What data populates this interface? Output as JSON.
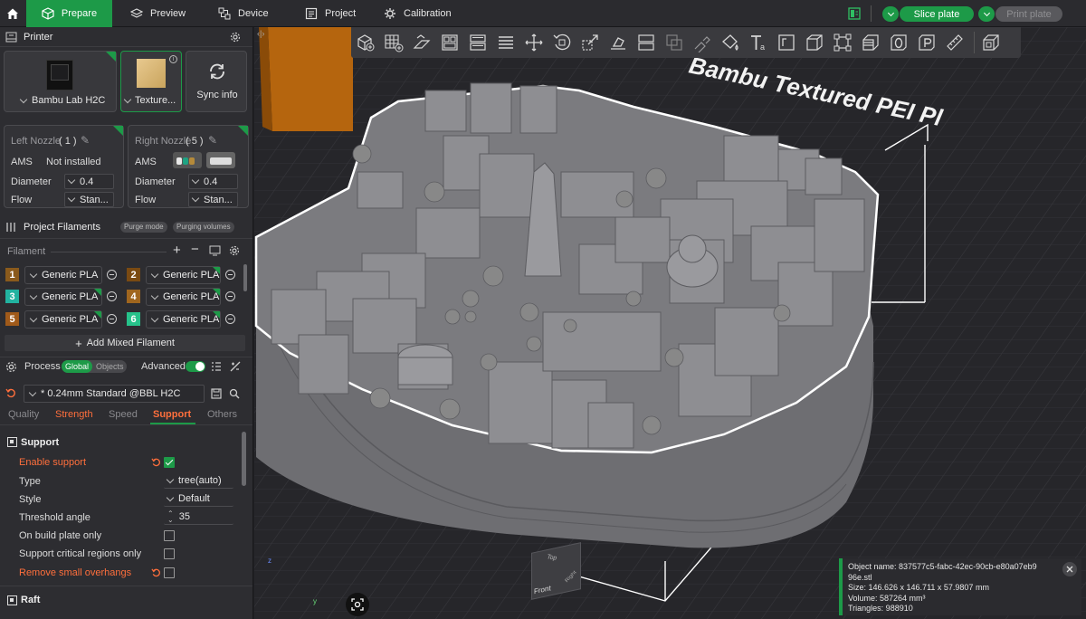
{
  "tabs": [
    {
      "label": "Prepare",
      "icon": "box-icon"
    },
    {
      "label": "Preview",
      "icon": "layers-icon"
    },
    {
      "label": "Device",
      "icon": "device-icon"
    },
    {
      "label": "Project",
      "icon": "project-icon"
    },
    {
      "label": "Calibration",
      "icon": "calibration-icon"
    }
  ],
  "topright": {
    "slice_label": "Slice plate",
    "print_label": "Print plate"
  },
  "printer": {
    "header": "Printer",
    "name": "Bambu Lab H2C",
    "plate": "Texture...",
    "sync": "Sync info",
    "left_nozzle": {
      "title": "Left Nozzle",
      "count": "( 1 )",
      "ams_label": "AMS",
      "ams_value": "Not installed",
      "diameter_label": "Diameter",
      "diameter": "0.4",
      "flow_label": "Flow",
      "flow": "Stan..."
    },
    "right_nozzle": {
      "title": "Right Nozzle",
      "count": "( 5 )",
      "ams_label": "AMS",
      "diameter_label": "Diameter",
      "diameter": "0.4",
      "flow_label": "Flow",
      "flow": "Stan..."
    }
  },
  "filaments": {
    "header": "Project Filaments",
    "purge_mode": "Purge mode",
    "purging_volumes": "Purging volumes",
    "label": "Filament",
    "items": [
      {
        "num": "1",
        "name": "Generic PLA",
        "color": "#8a5a1c"
      },
      {
        "num": "2",
        "name": "Generic PLA",
        "color": "#7a4a12"
      },
      {
        "num": "3",
        "name": "Generic PLA",
        "color": "#22b3a0"
      },
      {
        "num": "4",
        "name": "Generic PLA",
        "color": "#a0661e"
      },
      {
        "num": "5",
        "name": "Generic PLA",
        "color": "#a05a1a"
      },
      {
        "num": "6",
        "name": "Generic PLA",
        "color": "#26c28a"
      }
    ],
    "add_mixed": "Add Mixed Filament"
  },
  "process": {
    "header": "Process",
    "global": "Global",
    "objects": "Objects",
    "advanced": "Advanced",
    "preset": "* 0.24mm Standard @BBL H2C",
    "tabs": [
      "Quality",
      "Strength",
      "Speed",
      "Support",
      "Others"
    ],
    "active_tab": "Support"
  },
  "support": {
    "header": "Support",
    "enable_label": "Enable support",
    "type_label": "Type",
    "type_value": "tree(auto)",
    "style_label": "Style",
    "style_value": "Default",
    "threshold_label": "Threshold angle",
    "threshold_value": "35",
    "build_plate_label": "On build plate only",
    "critical_label": "Support critical regions only",
    "overhangs_label": "Remove small overhangs",
    "raft_header": "Raft"
  },
  "viewport": {
    "plate_text": "Bambu Textured PEI Pl",
    "cube_top": "Top",
    "cube_front": "Front",
    "cube_right": "Right",
    "axis_z": "z",
    "axis_y": "y"
  },
  "object_info": {
    "name": "Object name: 837577c5-fabc-42ec-90cb-e80a07eb9",
    "name2": "96e.stl",
    "size": "Size: 146.626 x 146.711 x 57.9807 mm",
    "volume": "Volume: 587264 mm³",
    "triangles": "Triangles: 988910"
  },
  "colors": {
    "accent": "#1d9a48",
    "warning": "#ff6f3c"
  }
}
